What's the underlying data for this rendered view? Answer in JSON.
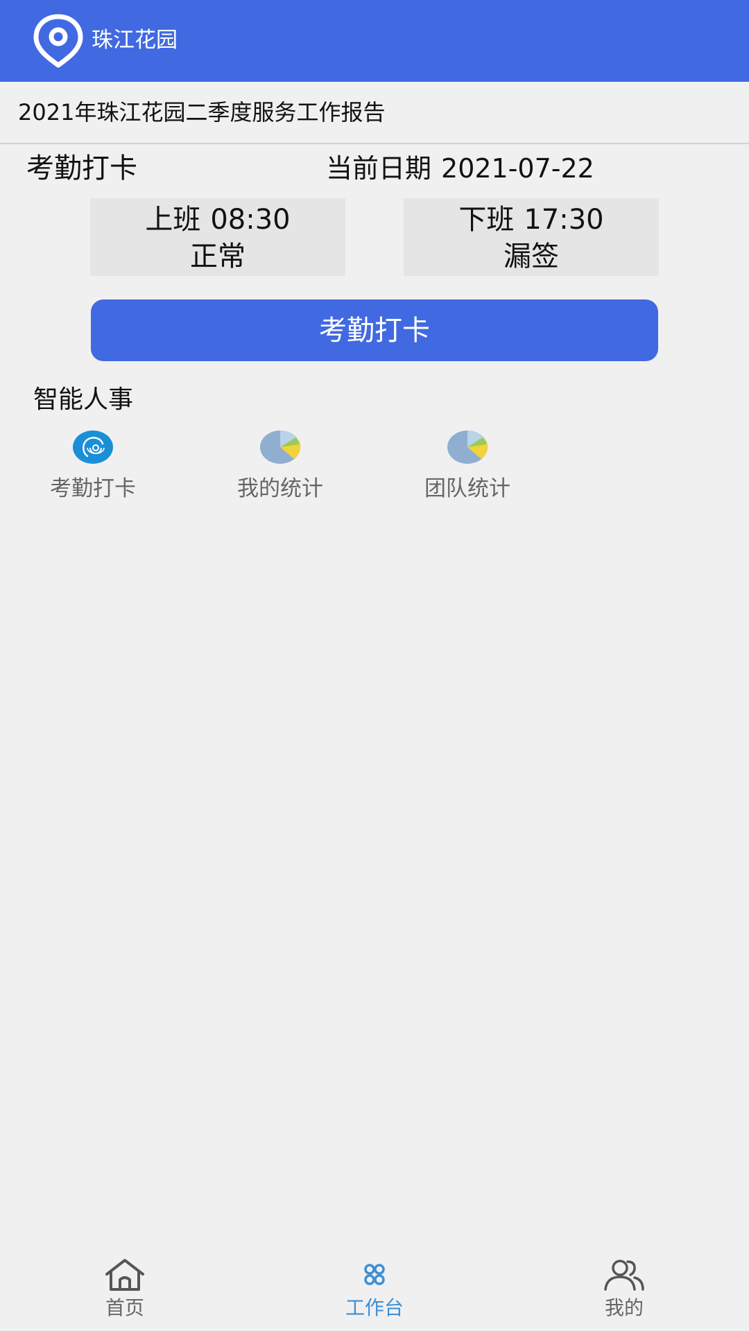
{
  "header": {
    "title": "珠江花园",
    "logo_icon": "location-pin-icon",
    "background": "#4169e1"
  },
  "notice": {
    "text": "2021年珠江花园二季度服务工作报告"
  },
  "attendance": {
    "title": "考勤打卡",
    "date_label": "当前日期",
    "date_value": "2021-07-22",
    "on_duty": {
      "label": "上班",
      "time": "08:30",
      "status": "正常"
    },
    "off_duty": {
      "label": "下班",
      "time": "17:30",
      "status": "漏签"
    },
    "button_label": "考勤打卡"
  },
  "smart_hr": {
    "title": "智能人事",
    "items": [
      {
        "label": "考勤打卡",
        "icon": "fingerprint-icon"
      },
      {
        "label": "我的统计",
        "icon": "pie-chart-icon"
      },
      {
        "label": "团队统计",
        "icon": "pie-chart-icon"
      }
    ]
  },
  "tabbar": {
    "items": [
      {
        "label": "首页",
        "icon": "home-icon",
        "active": false
      },
      {
        "label": "工作台",
        "icon": "workbench-icon",
        "active": true
      },
      {
        "label": "我的",
        "icon": "users-icon",
        "active": false
      }
    ],
    "active_color": "#3c8fd6"
  }
}
